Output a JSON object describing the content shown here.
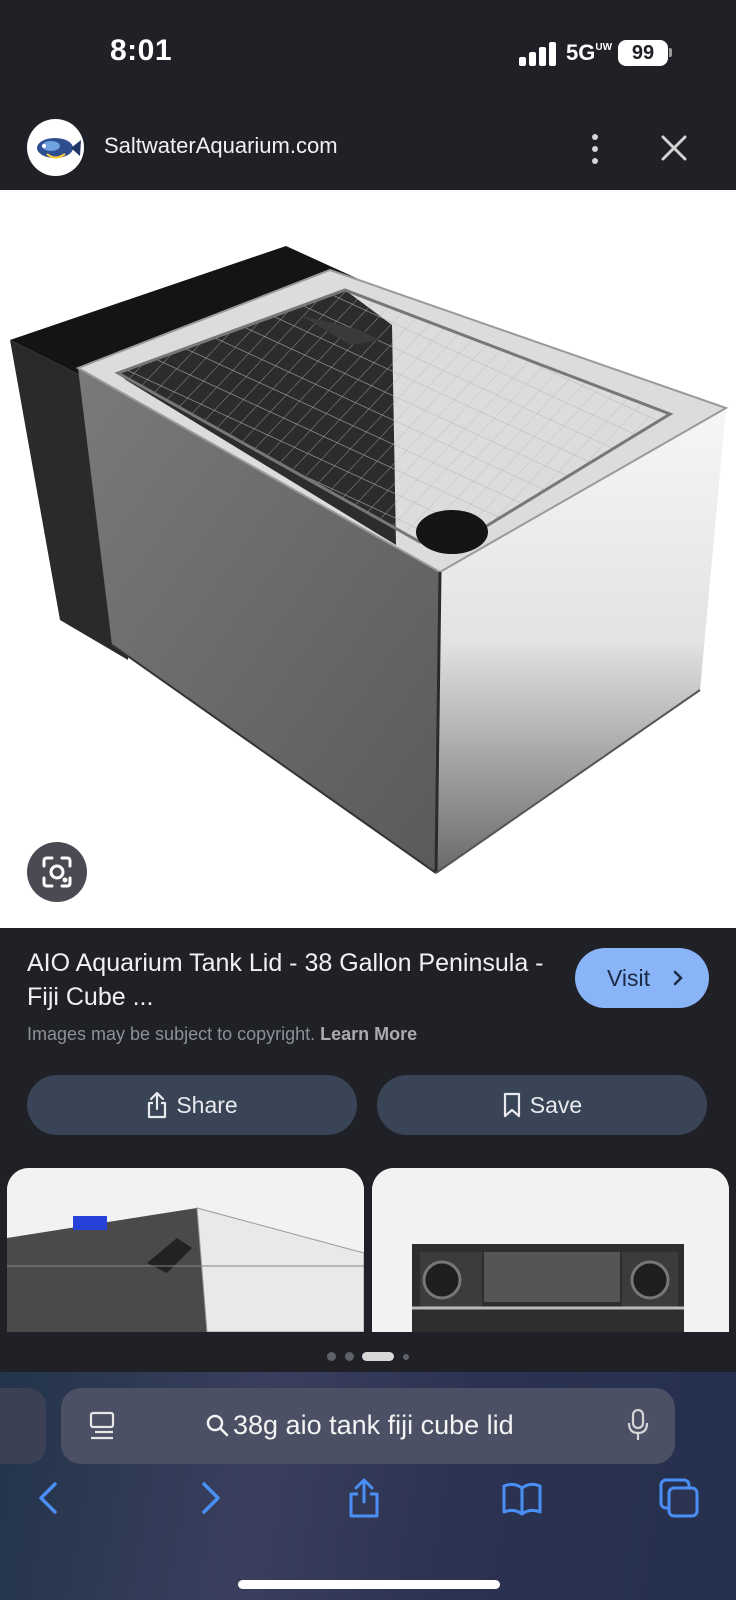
{
  "status_bar": {
    "time": "8:01",
    "network": "5G",
    "network_sup": "UW",
    "battery": "99"
  },
  "source": {
    "name": "SaltwaterAquarium.com",
    "logo_icon": "fish-logo-icon"
  },
  "result": {
    "title": "AIO Aquarium Tank Lid - 38 Gallon Peninsula - Fiji Cube ...",
    "visit_label": "Visit",
    "copyright_text": "Images may be subject to copyright.",
    "learn_more": "Learn More",
    "share_label": "Share",
    "save_label": "Save"
  },
  "carousel": {
    "total_pages": 4,
    "active_page": 3
  },
  "browser": {
    "search_query": "38g aio tank fiji cube lid",
    "accent": "#8ab4f8"
  }
}
